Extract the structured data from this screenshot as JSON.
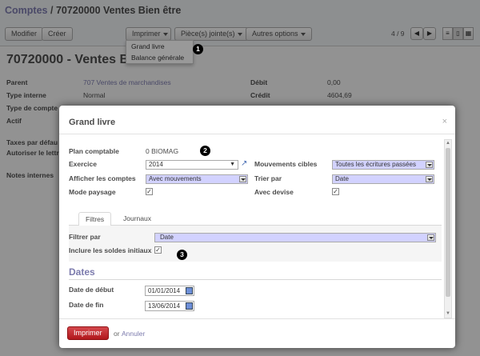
{
  "breadcrumb": {
    "parent": "Comptes",
    "separator": "/",
    "current": "70720000 Ventes Bien être"
  },
  "toolbar": {
    "edit_label": "Modifier",
    "create_label": "Créer",
    "print_label": "Imprimer",
    "attachments_label": "Pièce(s) jointe(s)",
    "more_label": "Autres options",
    "pager": "4 / 9"
  },
  "print_menu": {
    "items": [
      "Grand livre",
      "Balance générale"
    ]
  },
  "callouts": {
    "one": "1",
    "two": "2",
    "three": "3"
  },
  "record": {
    "title": "70720000 - Ventes B",
    "fields": {
      "parent_label": "Parent",
      "parent_value": "707 Ventes de marchandises",
      "internal_type_label": "Type interne",
      "internal_type_value": "Normal",
      "account_type_label": "Type de compte",
      "active_label": "Actif",
      "debit_label": "Débit",
      "debit_value": "0,00",
      "credit_label": "Crédit",
      "credit_value": "4604,69",
      "taxes_label": "Taxes par défau",
      "allow_label": "Autoriser le lettr",
      "notes_label": "Notes internes"
    }
  },
  "dialog": {
    "title": "Grand livre",
    "close": "×",
    "fields": {
      "chart_label": "Plan comptable",
      "chart_value": "0 BIOMAG",
      "fiscal_year_label": "Exercice",
      "fiscal_year_value": "2014",
      "display_accounts_label": "Afficher les comptes",
      "display_accounts_value": "Avec mouvements",
      "landscape_label": "Mode paysage",
      "target_moves_label": "Mouvements cibles",
      "target_moves_value": "Toutes les écritures passées",
      "sort_by_label": "Trier par",
      "sort_by_value": "Date",
      "currency_label": "Avec devise"
    },
    "tabs": [
      "Filtres",
      "Journaux"
    ],
    "filters": {
      "filter_by_label": "Filtrer par",
      "filter_by_value": "Date",
      "initial_balance_label": "Inclure les soldes initiaux"
    },
    "dates": {
      "section_title": "Dates",
      "start_label": "Date de début",
      "start_value": "01/01/2014",
      "end_label": "Date de fin",
      "end_value": "13/06/2014"
    },
    "footer": {
      "print_label": "Imprimer",
      "or_label": "or",
      "cancel_label": "Annuler"
    }
  },
  "colors": {
    "accent": "#7c7bad",
    "primary_button": "#b1171c",
    "required_field": "#d2d2ff"
  }
}
